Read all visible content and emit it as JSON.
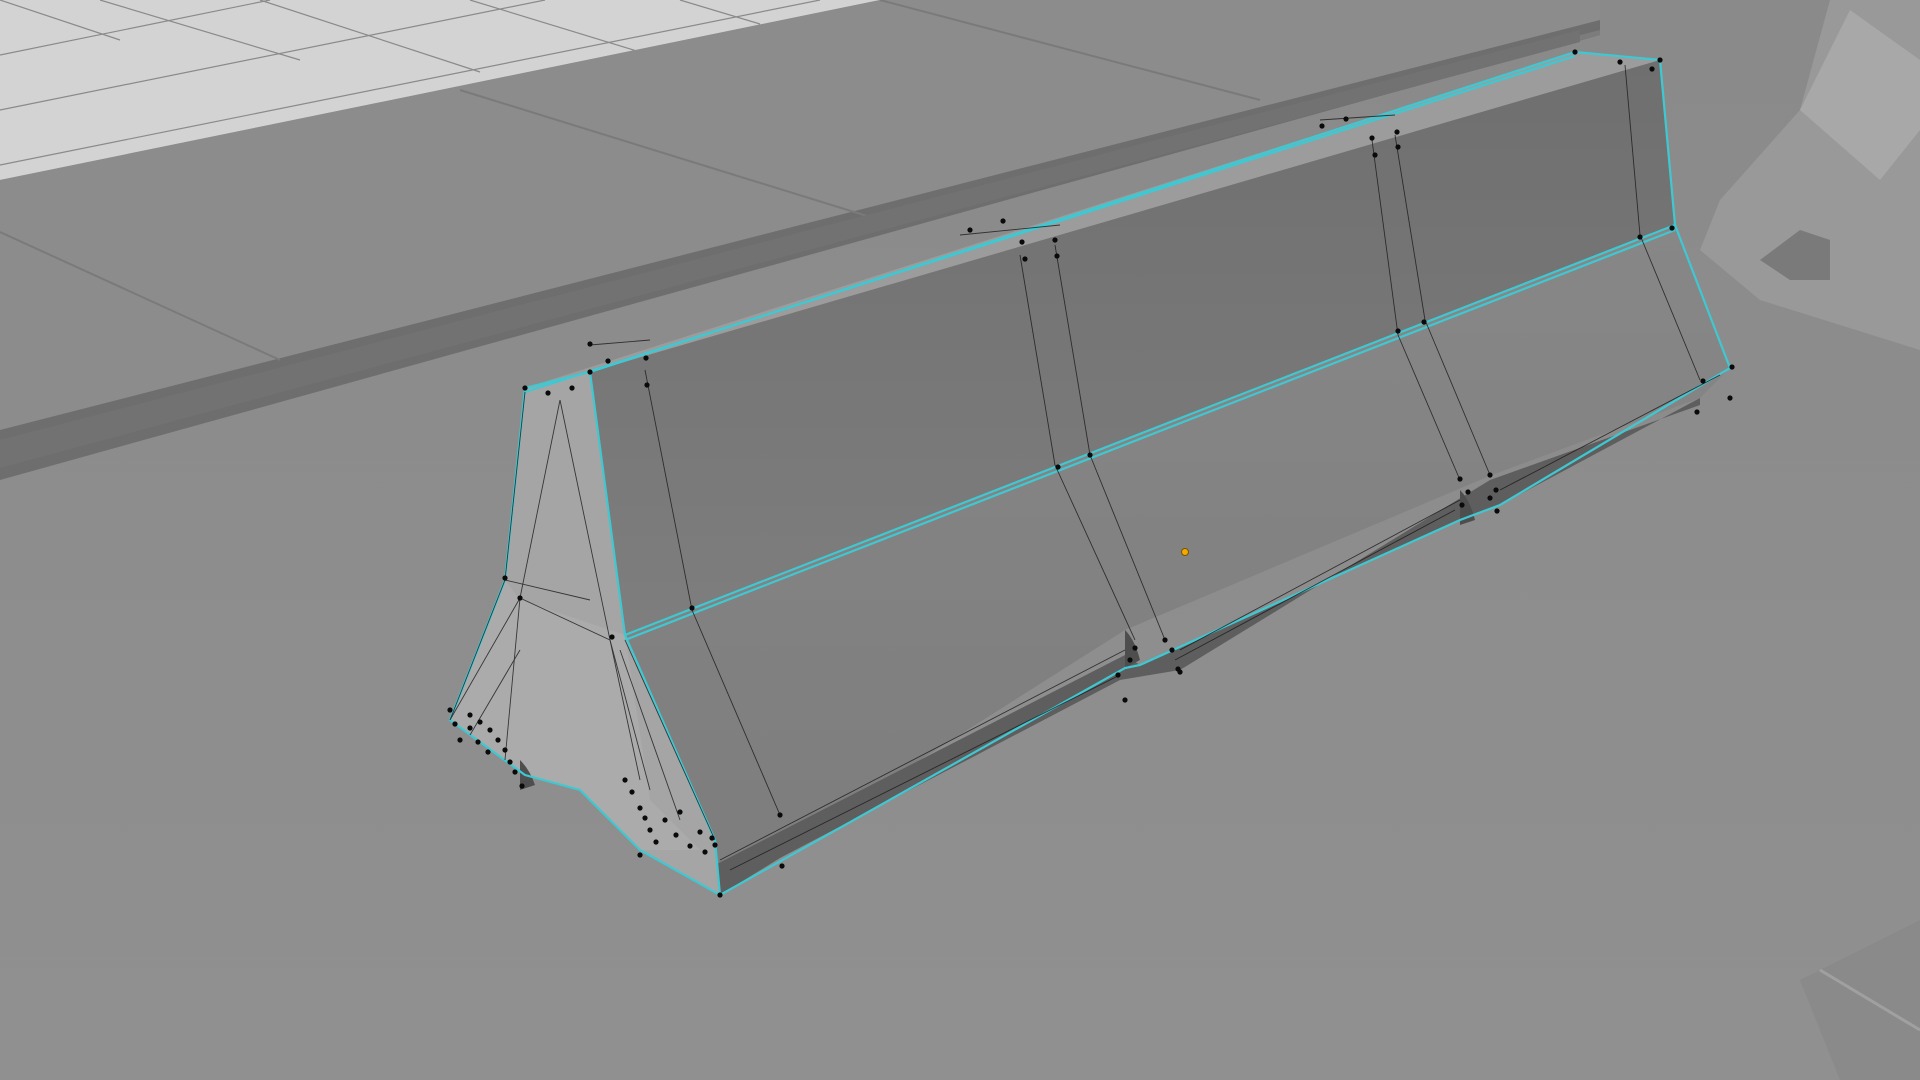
{
  "viewport": {
    "view": "perspective",
    "background_color": "#8e8e8e",
    "selection_color": "#3fc8d2",
    "vertex_color": "#0a0a0a",
    "pivot_color": "#f2a900"
  },
  "scene": {
    "selected_object": "jersey-barrier",
    "objects": [
      "road-ground",
      "sidewalk-curb",
      "grid-tiles",
      "jersey-barrier",
      "background-barrier"
    ],
    "component_mode": "vertex"
  }
}
